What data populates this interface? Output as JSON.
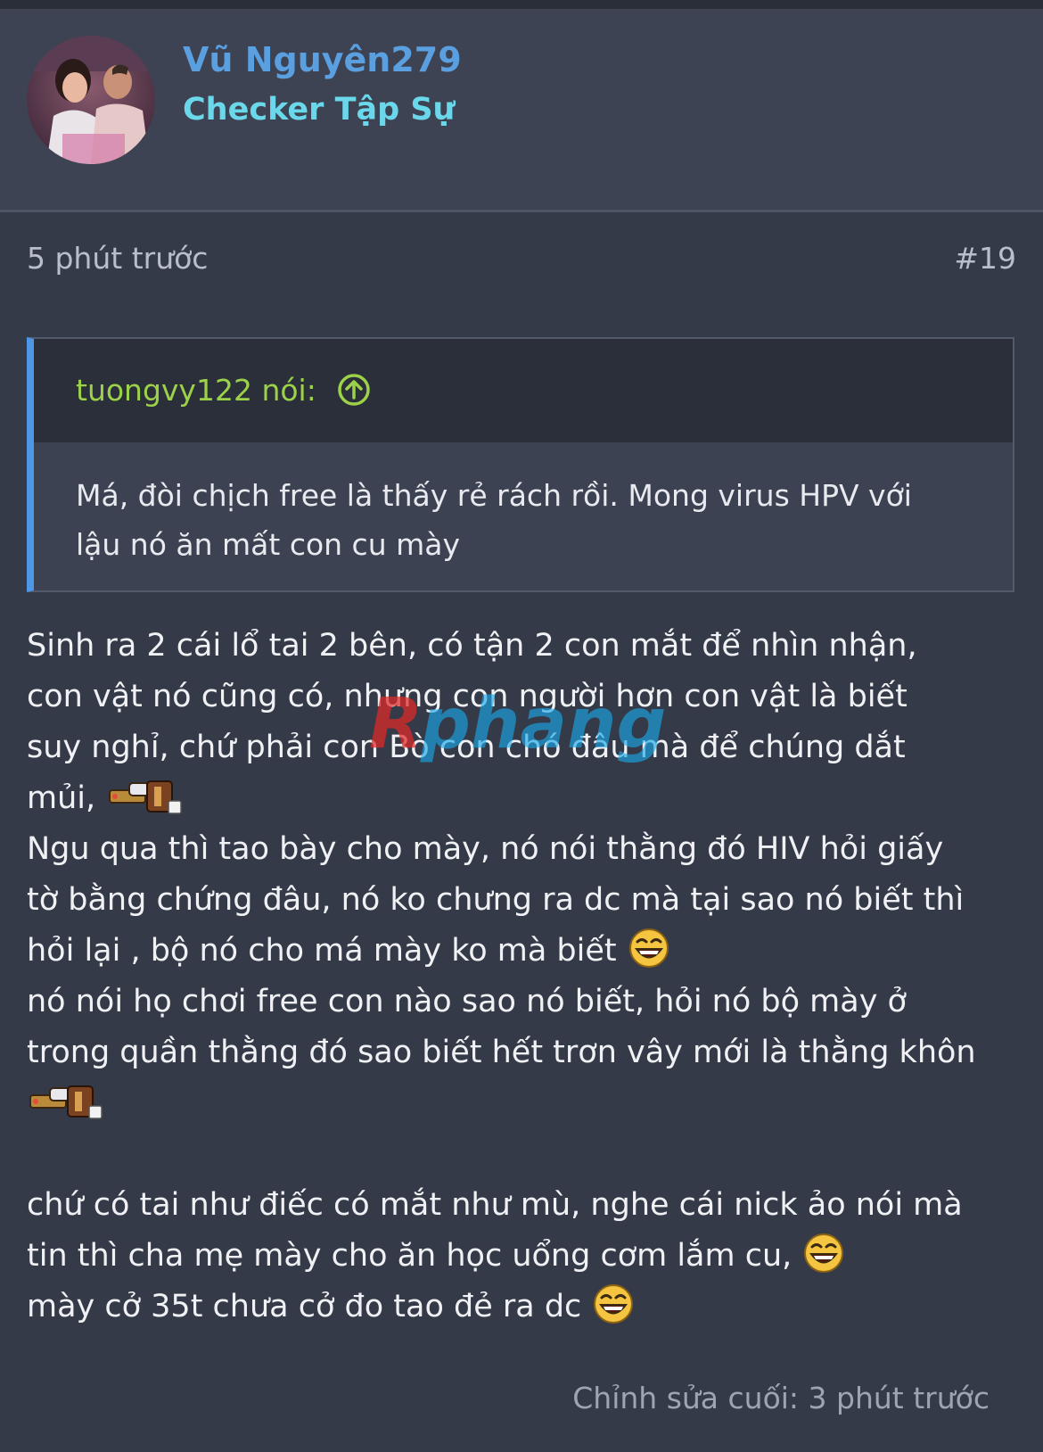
{
  "header": {
    "username": "Vũ Nguyên279",
    "user_title": "Checker Tập Sự"
  },
  "post": {
    "timestamp": "5 phút trước",
    "number": "#19",
    "quote": {
      "author": "tuongvy122 nói:",
      "lines": [
        "Má, đòi chịch free là thấy rẻ rách rồi. Mong virus HPV với",
        "lậu nó ăn mất con cu mày"
      ]
    },
    "body_lines": [
      "Sinh ra 2 cái lổ tai 2 bên, có tận 2 con mắt để nhìn nhận,",
      "con vật nó cũng có, nhưng con người hơn con vật là biết",
      "suy nghỉ, chứ phải con Bò con chó đâu mà để chúng dắt",
      "mủi,",
      "Ngu qua thì tao bày cho mày, nó nói thằng đó HIV hỏi giấy",
      "tờ bằng chứng đâu, nó ko chưng ra dc mà tại sao nó biết thì",
      "hỏi lại , bộ nó cho má mày ko mà biết",
      "nó nói họ chơi free con nào sao nó biết, hỏi nó bộ mày ở",
      "trong quần thằng đó sao biết hết trơn vây mới là thằng khôn",
      "chứ có tai như điếc có mắt như mù, nghe cái nick ảo nói mà",
      "tin thì cha mẹ mày cho ăn học uổng cơm lắm cu,",
      "mày cở 35t chưa cở đo tao đẻ ra dc"
    ],
    "edited": "Chỉnh sửa cuối: 3 phút trước"
  },
  "watermark": "Rphang",
  "icons": {
    "quote_jump": "arrow-up-circle-icon",
    "laugh": "laugh-emoji-icon",
    "sticker": "gun-sticker-icon"
  },
  "colors": {
    "background": "#353a48",
    "header_bg": "#3d4352",
    "username": "#5a9fe0",
    "user_title": "#6ad8ea",
    "quote_author": "#9cd14a",
    "quote_border": "#4c98e6"
  }
}
